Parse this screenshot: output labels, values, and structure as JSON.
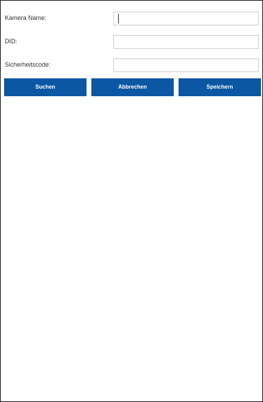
{
  "form": {
    "fields": [
      {
        "label": "Kamera Name:",
        "value": "",
        "placeholder": ""
      },
      {
        "label": "DID:",
        "value": "",
        "placeholder": ""
      },
      {
        "label": "Sicherheitscode:",
        "value": "",
        "placeholder": ""
      }
    ]
  },
  "buttons": {
    "search_label": "Suchen",
    "cancel_label": "Abbrechen",
    "save_label": "Speichern"
  },
  "colors": {
    "button_bg": "#0c57a3",
    "button_text": "#ffffff",
    "input_border": "#cfcfcf"
  }
}
